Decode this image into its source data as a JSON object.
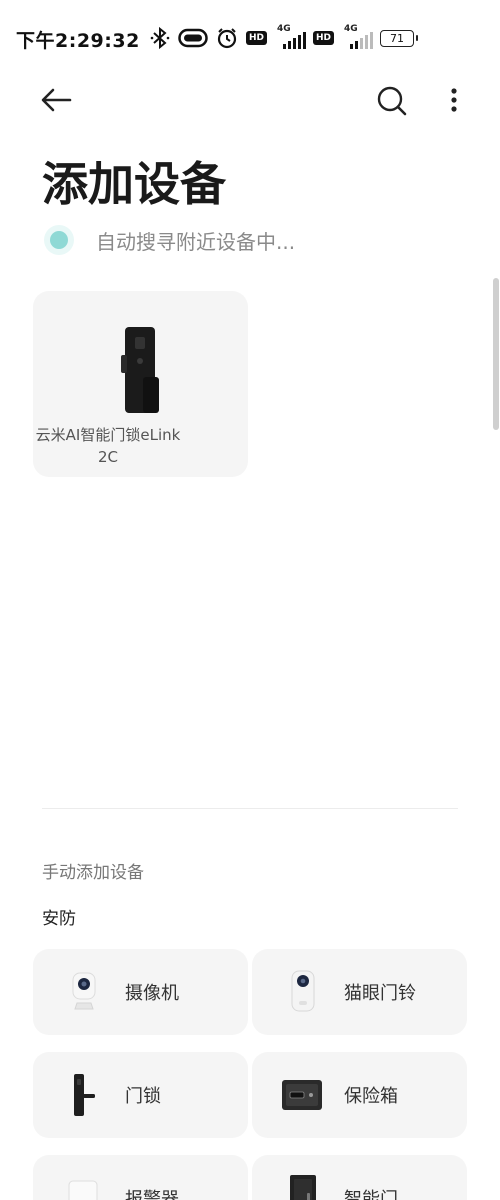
{
  "status_bar": {
    "time": "下午2:29:32",
    "hd1": "HD",
    "hd2": "HD",
    "net1": "4G",
    "net2": "4G",
    "battery": "71",
    "icons": [
      "bluetooth-icon",
      "toggle-icon",
      "alarm-icon",
      "hd-icon",
      "signal-icon",
      "hd-icon",
      "signal-icon",
      "battery-icon"
    ]
  },
  "header": {
    "icons": [
      "back-arrow-icon",
      "search-icon",
      "more-vertical-icon"
    ]
  },
  "page": {
    "title": "添加设备",
    "scanning_text": "自动搜寻附近设备中..."
  },
  "discovered": {
    "devices": [
      {
        "name_line1": "云米AI智能门锁eLink",
        "name_line2": "2C",
        "icon": "smart-lock-icon"
      }
    ]
  },
  "manual": {
    "section_title": "手动添加设备",
    "category": "安防",
    "items": [
      {
        "label": "摄像机",
        "icon": "camera-icon"
      },
      {
        "label": "猫眼门铃",
        "icon": "peephole-doorbell-icon"
      },
      {
        "label": "门锁",
        "icon": "door-lock-icon"
      },
      {
        "label": "保险箱",
        "icon": "safe-icon"
      },
      {
        "label": "报警器",
        "icon": "alarm-sensor-icon"
      },
      {
        "label": "智能门",
        "icon": "smart-door-icon"
      }
    ]
  },
  "colors": {
    "scan_dot": "#8fd9d5",
    "card_bg": "#f5f5f5"
  }
}
